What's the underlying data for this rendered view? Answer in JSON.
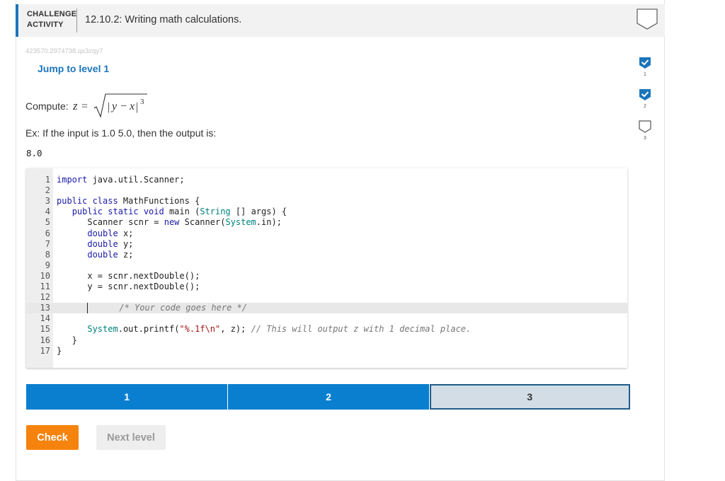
{
  "header": {
    "badge_line1": "CHALLENGE",
    "badge_line2": "ACTIVITY",
    "title": "12.10.2: Writing math calculations."
  },
  "activity_id": "423570.2974738.qx3zqy7",
  "jump_link": "Jump to level 1",
  "prompt": {
    "compute_label": "Compute: ",
    "formula_text": "z = √|y − x|³",
    "example": "Ex: If the input is 1.0 5.0, then the output is:",
    "output": "8.0"
  },
  "code_lines": [
    {
      "num": "1",
      "html": "<span class=\"kw\">import</span> java.util.Scanner;"
    },
    {
      "num": "2",
      "html": ""
    },
    {
      "num": "3",
      "html": "<span class=\"kw\">public class</span> MathFunctions {"
    },
    {
      "num": "4",
      "html": "   <span class=\"kw\">public static void</span> main (<span class=\"ty\">String</span> [] args) {"
    },
    {
      "num": "5",
      "html": "      Scanner scnr = <span class=\"kw\">new</span> Scanner(<span class=\"ty\">System</span>.in);"
    },
    {
      "num": "6",
      "html": "      <span class=\"kw\">double</span> x;"
    },
    {
      "num": "7",
      "html": "      <span class=\"kw\">double</span> y;"
    },
    {
      "num": "8",
      "html": "      <span class=\"kw\">double</span> z;"
    },
    {
      "num": "9",
      "html": ""
    },
    {
      "num": "10",
      "html": "      x = scnr.nextDouble();"
    },
    {
      "num": "11",
      "html": "      y = scnr.nextDouble();"
    },
    {
      "num": "12",
      "html": ""
    },
    {
      "num": "13",
      "html": "      <span class=\"cm\">/* Your code goes here */</span>",
      "active": true
    },
    {
      "num": "14",
      "html": ""
    },
    {
      "num": "15",
      "html": "      <span class=\"ty\">System</span>.out.printf(<span class=\"st\">\"%.1f\\n\"</span>, z); <span class=\"cm\">// This will output z with 1 decimal place.</span>"
    },
    {
      "num": "16",
      "html": "   }"
    },
    {
      "num": "17",
      "html": "}"
    }
  ],
  "progress": [
    {
      "label": "1",
      "state": "done"
    },
    {
      "label": "2",
      "state": "done"
    },
    {
      "label": "3",
      "state": "current"
    }
  ],
  "buttons": {
    "check": "Check",
    "next_level": "Next level"
  },
  "levels": [
    {
      "label": "1",
      "status": "complete"
    },
    {
      "label": "2",
      "status": "complete"
    },
    {
      "label": "3",
      "status": "incomplete"
    }
  ],
  "colors": {
    "accent": "#1b75bb",
    "progress_done": "#0a7fd0",
    "check": "#f5830d"
  }
}
